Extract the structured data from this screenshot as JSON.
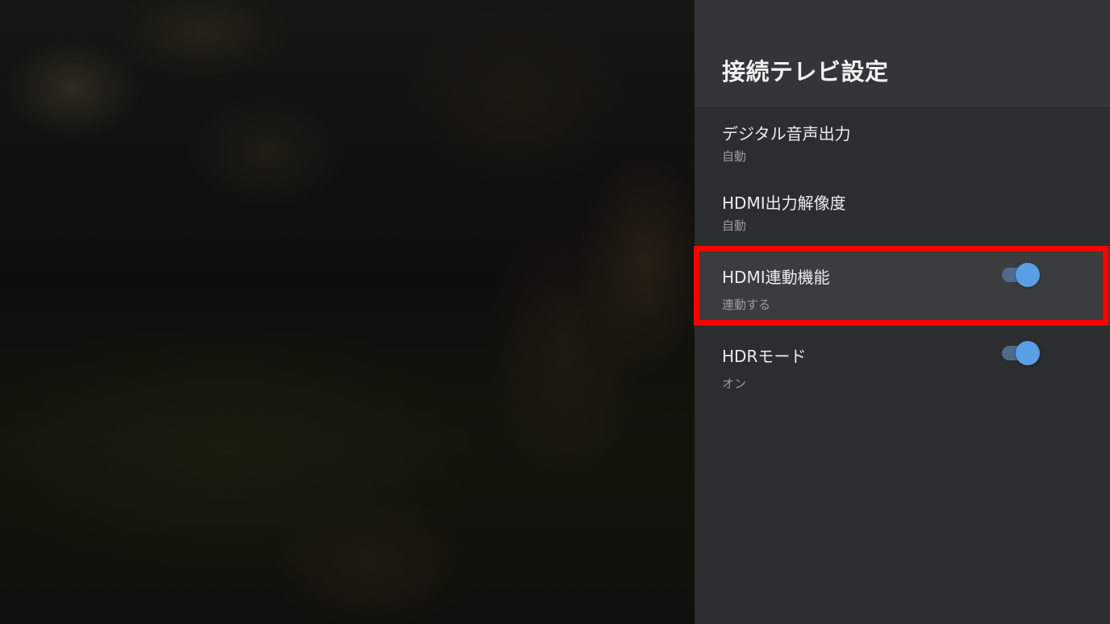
{
  "panel": {
    "title": "接続テレビ設定"
  },
  "items": [
    {
      "label": "デジタル音声出力",
      "value": "自動"
    },
    {
      "label": "HDMI出力解像度",
      "value": "自動"
    },
    {
      "label": "HDMI連動機能",
      "value": "連動する",
      "toggle_on": true,
      "highlighted": true
    },
    {
      "label": "HDRモード",
      "value": "オン",
      "toggle_on": true
    }
  ],
  "colors": {
    "panel_bg": "#2c2d2f",
    "header_bg": "#343537",
    "selected_bg": "#3b3c3e",
    "highlight_border": "#ff0000",
    "toggle_knob": "#5a9ee6",
    "toggle_track": "#4e6a8f"
  }
}
